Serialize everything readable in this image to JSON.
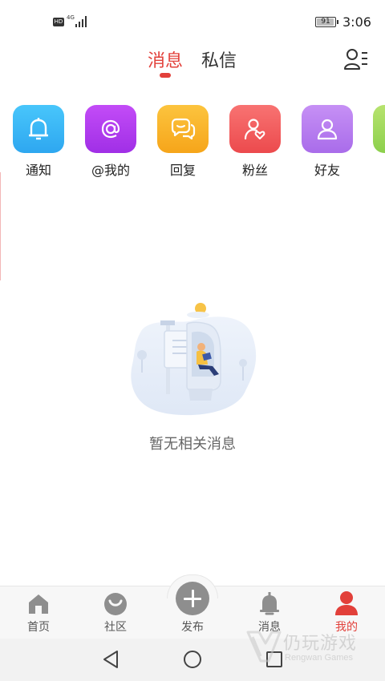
{
  "status_bar": {
    "hd": "HD",
    "network": "4G",
    "battery": "91",
    "time": "3:06"
  },
  "header": {
    "tab_messages": "消息",
    "tab_private": "私信",
    "contacts_icon": "contacts-list-icon",
    "accent_color": "#e2403a"
  },
  "categories": [
    {
      "label": "通知",
      "icon": "bell-icon",
      "color": "#3cb3f5"
    },
    {
      "label": "@我的",
      "icon": "at-icon",
      "color": "#b43ff0"
    },
    {
      "label": "回复",
      "icon": "chat-bubbles-icon",
      "color": "#f9b32a"
    },
    {
      "label": "粉丝",
      "icon": "fan-heart-icon",
      "color": "#f25f5f"
    },
    {
      "label": "好友",
      "icon": "person-icon",
      "color": "#b880f0"
    }
  ],
  "empty_state": {
    "text": "暂无相关消息",
    "illustration": "mailbox-reading-illustration"
  },
  "bottom_nav": {
    "home": "首页",
    "community": "社区",
    "publish": "发布",
    "messages": "消息",
    "mine": "我的",
    "active": "mine"
  },
  "watermark": {
    "title": "仍玩游戏",
    "subtitle": "Rengwan Games"
  }
}
